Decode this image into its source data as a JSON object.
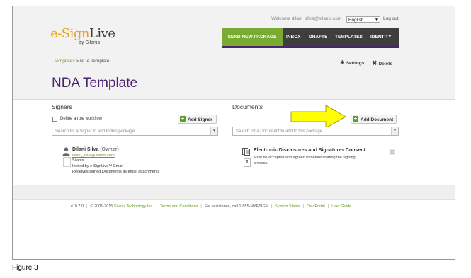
{
  "header": {
    "welcome_prefix": "Welcome ",
    "user_email": "dilani_silva@silanis.com",
    "language": "English",
    "logout_label": "Log out"
  },
  "logo": {
    "brand_prefix": "e-Sign",
    "brand_suffix": "Live",
    "by_line": "by Silanis"
  },
  "nav": {
    "send_label": "SEND NEW PACKAGE",
    "items": [
      "INBOX",
      "DRAFTS",
      "TEMPLATES",
      "IDENTITY"
    ]
  },
  "breadcrumb": {
    "link": "Templates",
    "separator": " > ",
    "current": "NDA Template"
  },
  "actions": {
    "settings_label": "Settings",
    "delete_label": "Delete"
  },
  "page_title": "NDA Template",
  "signers": {
    "title": "Signers",
    "role_workflow_label": "Define a role workflow",
    "add_label": "Add Signer",
    "search_placeholder": "Search for a Signer to add to this package",
    "list": [
      {
        "name": "Dilani Silva",
        "role": "(Owner)",
        "email": "dilani_silva@silanis.com",
        "company": "Silanis",
        "invite": "Invited by e-SignLive™ Email",
        "delivery": "Receives signed Documents as email attachments"
      }
    ]
  },
  "documents": {
    "title": "Documents",
    "add_label": "Add Document",
    "search_placeholder": "Search for a Document to add to this package",
    "list": [
      {
        "name": "Electronic Disclosures and Signatures Consent",
        "desc_line1": "Must be accepted and agreed to before starting the signing",
        "desc_line2": "process.",
        "order": "1"
      }
    ]
  },
  "footer": {
    "version": "v10.7.0",
    "copyright_prefix": "© 2001-2015 ",
    "copyright_company": "Silanis Technology Inc.",
    "terms": "Terms and Conditions",
    "assistance": "For assistance, call 1-855-MYESIGN",
    "status": "System Status",
    "dev_portal": "Dev Portal",
    "user_guide": "User Guide"
  },
  "caption": "Figure 3",
  "colors": {
    "brand_purple": "#4b2470",
    "brand_green": "#7aab31",
    "link_green": "#6a9a2a",
    "arrow_yellow": "#ffff00"
  },
  "icons": {
    "settings": "gear-icon",
    "delete": "x-icon",
    "signer": "person-icon",
    "document": "document-icon",
    "remove": "close-icon",
    "add": "plus-icon",
    "annotation": "arrow-right-icon"
  }
}
